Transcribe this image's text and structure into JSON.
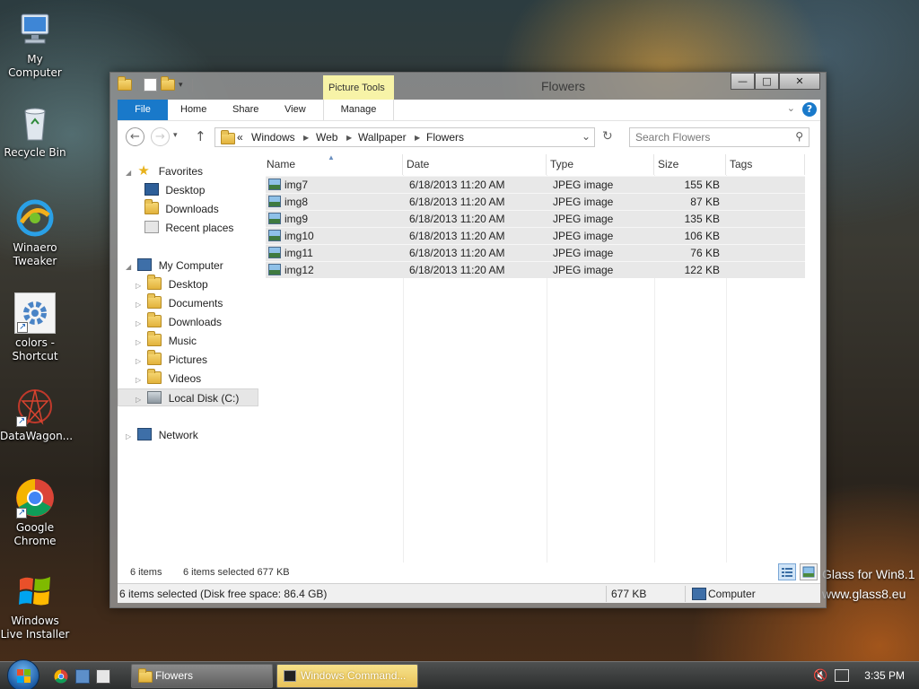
{
  "desktop": {
    "icons": [
      {
        "label": "My Computer"
      },
      {
        "label": "Recycle Bin"
      },
      {
        "label": "Winaero Tweaker"
      },
      {
        "label": "colors - Shortcut"
      },
      {
        "label": "DataWagon..."
      },
      {
        "label": "Google Chrome"
      },
      {
        "label": "Windows Live Installer"
      }
    ],
    "watermark_line1": "Glass for Win8.1",
    "watermark_line2": "www.glass8.eu"
  },
  "window": {
    "title": "Flowers",
    "contextual_tab": "Picture Tools",
    "buttons": {
      "minimize": "—",
      "maximize": "□",
      "close": "✕"
    }
  },
  "ribbon": {
    "tabs": [
      "File",
      "Home",
      "Share",
      "View",
      "Manage"
    ],
    "help": "?"
  },
  "address": {
    "overflow": "«",
    "crumbs": [
      "Windows",
      "Web",
      "Wallpaper",
      "Flowers"
    ],
    "search_placeholder": "Search Flowers"
  },
  "navpane": {
    "favorites": {
      "label": "Favorites",
      "items": [
        "Desktop",
        "Downloads",
        "Recent places"
      ]
    },
    "computer": {
      "label": "My Computer",
      "items": [
        "Desktop",
        "Documents",
        "Downloads",
        "Music",
        "Pictures",
        "Videos",
        "Local Disk (C:)"
      ]
    },
    "network": {
      "label": "Network"
    }
  },
  "files": {
    "columns": [
      "Name",
      "Date",
      "Type",
      "Size",
      "Tags"
    ],
    "rows": [
      {
        "name": "img7",
        "date": "6/18/2013 11:20 AM",
        "type": "JPEG image",
        "size": "155 KB"
      },
      {
        "name": "img8",
        "date": "6/18/2013 11:20 AM",
        "type": "JPEG image",
        "size": "87 KB"
      },
      {
        "name": "img9",
        "date": "6/18/2013 11:20 AM",
        "type": "JPEG image",
        "size": "135 KB"
      },
      {
        "name": "img10",
        "date": "6/18/2013 11:20 AM",
        "type": "JPEG image",
        "size": "106 KB"
      },
      {
        "name": "img11",
        "date": "6/18/2013 11:20 AM",
        "type": "JPEG image",
        "size": "76 KB"
      },
      {
        "name": "img12",
        "date": "6/18/2013 11:20 AM",
        "type": "JPEG image",
        "size": "122 KB"
      }
    ]
  },
  "status": {
    "count": "6 items",
    "selected": "6 items selected  677 KB",
    "details": "6 items selected (Disk free space: 86.4 GB)",
    "size": "677 KB",
    "location": "Computer"
  },
  "taskbar": {
    "buttons": [
      "Flowers",
      "Windows Command..."
    ],
    "clock": "3:35 PM"
  }
}
